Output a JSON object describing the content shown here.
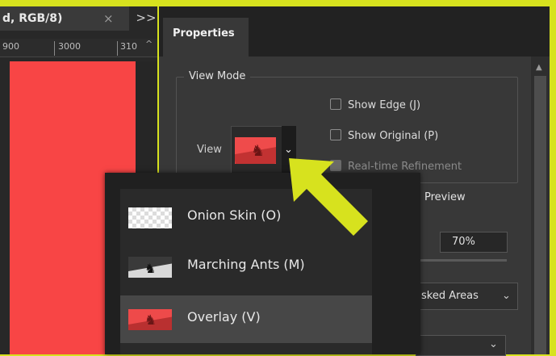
{
  "colors": {
    "frame_accent": "#d7e21e",
    "panel_dark": "#282828",
    "properties_bg": "#383838",
    "canvas_red": "#f84545",
    "menu_selected": "#474747"
  },
  "document": {
    "tab_title": "d, RGB/8)",
    "close_icon": "×",
    "expand_icon": ">>",
    "ruler_labels": [
      "900",
      "3000",
      "310"
    ],
    "ruler_up_icon": "^"
  },
  "properties": {
    "tab_label": "Properties",
    "view_mode_title": "View Mode",
    "view_label": "View",
    "dropdown_chevron": "⌄",
    "checkboxes": [
      {
        "label": "Show Edge (J)",
        "checked": false,
        "enabled": true
      },
      {
        "label": "Show Original (P)",
        "checked": false,
        "enabled": true
      },
      {
        "label": "Real-time Refinement",
        "checked": true,
        "enabled": false
      }
    ],
    "preview_label": "Preview",
    "opacity_value": "70%",
    "masked_select_value": "sked Areas",
    "select_chevron": "⌄"
  },
  "view_menu": {
    "items": [
      {
        "label": "Onion Skin (O)",
        "icon": "onion-skin-thumbnail"
      },
      {
        "label": "Marching Ants (M)",
        "icon": "marching-ants-thumbnail"
      },
      {
        "label": "Overlay (V)",
        "icon": "overlay-thumbnail",
        "selected": true
      }
    ]
  },
  "annotation": {
    "arrow_color": "#d7e21e"
  }
}
